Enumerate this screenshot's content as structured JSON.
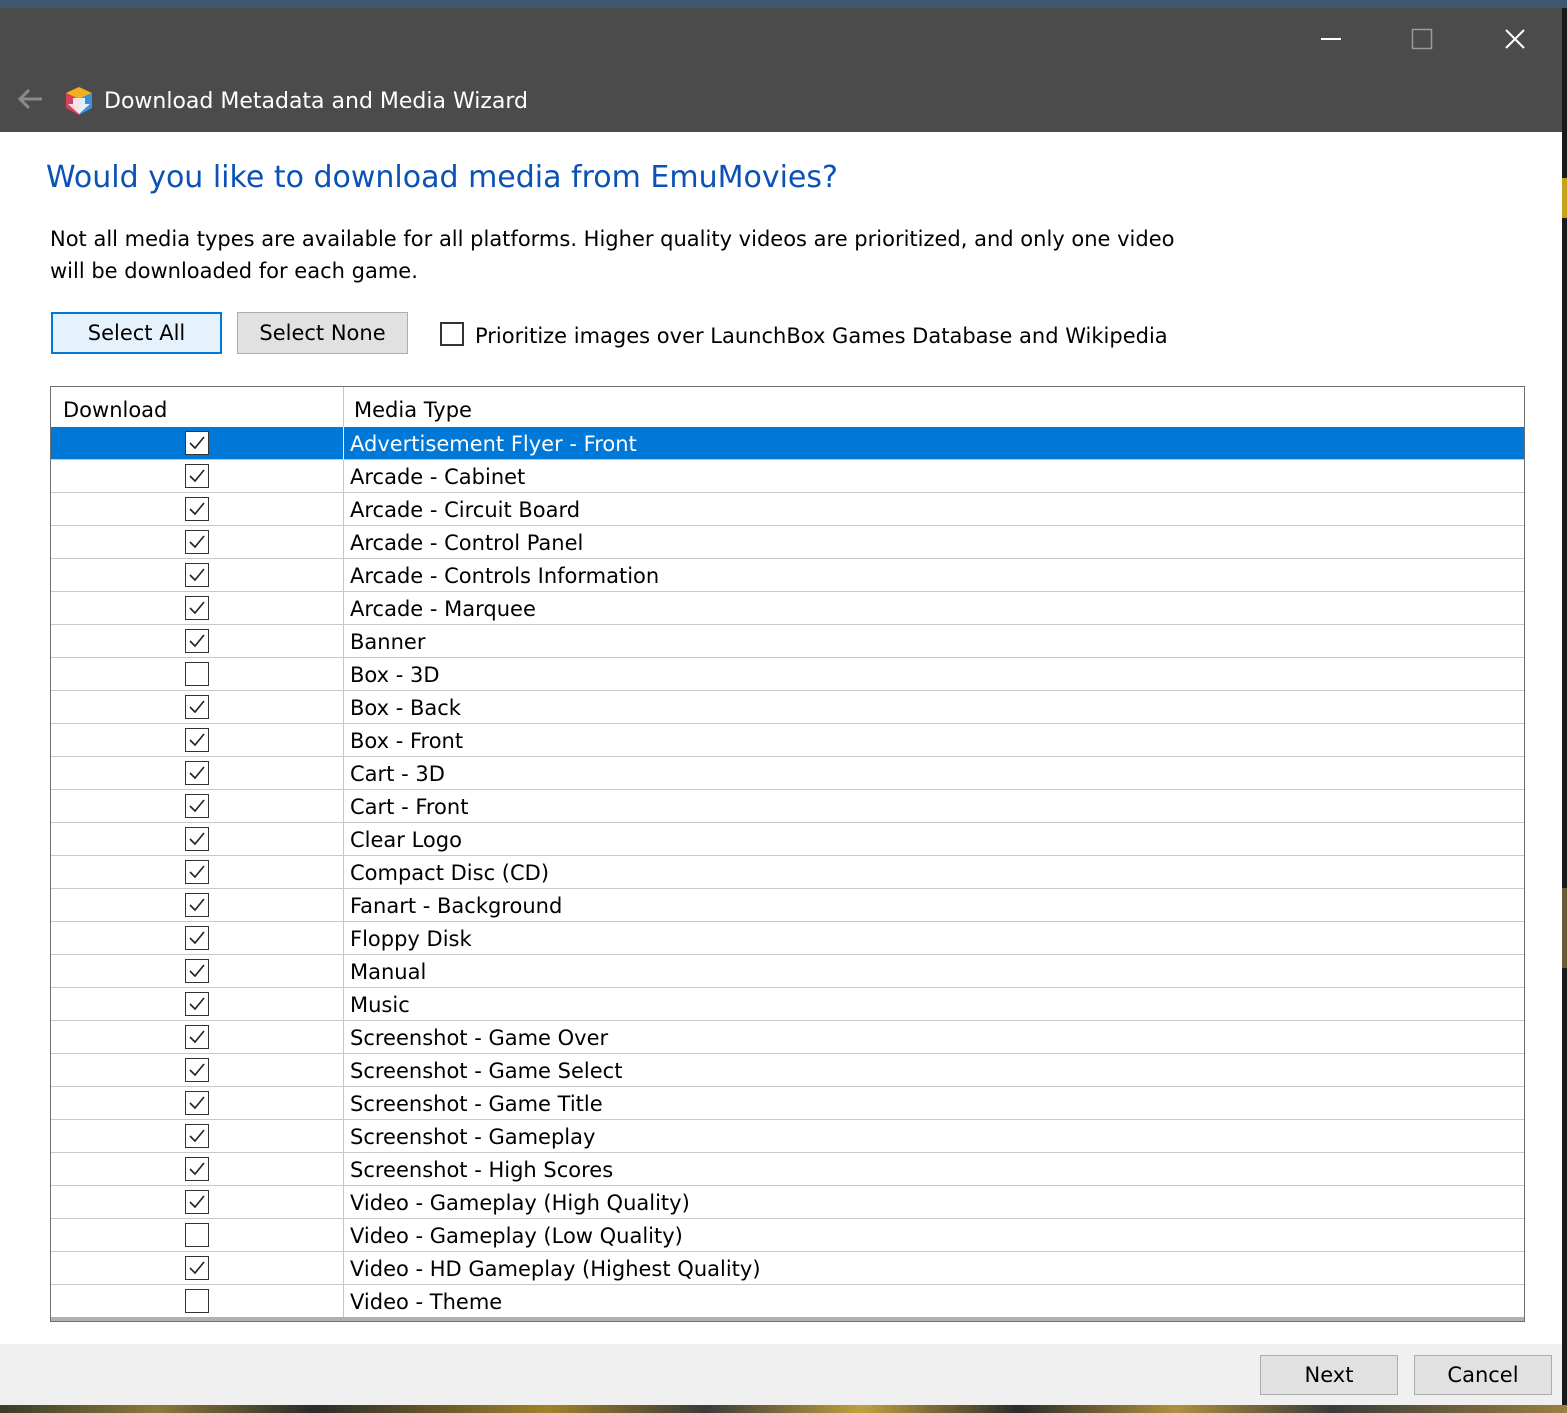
{
  "window": {
    "title": "Download Metadata and Media Wizard",
    "icons": {
      "back": "back-arrow-icon",
      "app": "launchbox-wizard-icon",
      "minimize": "minimize-icon",
      "maximize": "maximize-icon",
      "close": "close-icon"
    }
  },
  "content": {
    "heading": "Would you like to download media from EmuMovies?",
    "description": "Not all media types are available for all platforms. Higher quality videos are prioritized, and only one video will be downloaded for each game.",
    "select_all_label": "Select All",
    "select_none_label": "Select None",
    "prioritize_label": "Prioritize images over LaunchBox Games Database and Wikipedia",
    "prioritize_checked": false
  },
  "grid": {
    "columns": [
      "Download",
      "Media Type"
    ],
    "selected_index": 0,
    "rows": [
      {
        "checked": true,
        "media_type": "Advertisement Flyer - Front"
      },
      {
        "checked": true,
        "media_type": "Arcade - Cabinet"
      },
      {
        "checked": true,
        "media_type": "Arcade - Circuit Board"
      },
      {
        "checked": true,
        "media_type": "Arcade - Control Panel"
      },
      {
        "checked": true,
        "media_type": "Arcade - Controls Information"
      },
      {
        "checked": true,
        "media_type": "Arcade - Marquee"
      },
      {
        "checked": true,
        "media_type": "Banner"
      },
      {
        "checked": false,
        "media_type": "Box - 3D"
      },
      {
        "checked": true,
        "media_type": "Box - Back"
      },
      {
        "checked": true,
        "media_type": "Box - Front"
      },
      {
        "checked": true,
        "media_type": "Cart - 3D"
      },
      {
        "checked": true,
        "media_type": "Cart - Front"
      },
      {
        "checked": true,
        "media_type": "Clear Logo"
      },
      {
        "checked": true,
        "media_type": "Compact Disc (CD)"
      },
      {
        "checked": true,
        "media_type": "Fanart - Background"
      },
      {
        "checked": true,
        "media_type": "Floppy Disk"
      },
      {
        "checked": true,
        "media_type": "Manual"
      },
      {
        "checked": true,
        "media_type": "Music"
      },
      {
        "checked": true,
        "media_type": "Screenshot - Game Over"
      },
      {
        "checked": true,
        "media_type": "Screenshot - Game Select"
      },
      {
        "checked": true,
        "media_type": "Screenshot - Game Title"
      },
      {
        "checked": true,
        "media_type": "Screenshot - Gameplay"
      },
      {
        "checked": true,
        "media_type": "Screenshot - High Scores"
      },
      {
        "checked": true,
        "media_type": "Video - Gameplay (High Quality)"
      },
      {
        "checked": false,
        "media_type": "Video - Gameplay (Low Quality)"
      },
      {
        "checked": true,
        "media_type": "Video - HD Gameplay (Highest Quality)"
      },
      {
        "checked": false,
        "media_type": "Video - Theme"
      }
    ]
  },
  "footer": {
    "next_label": "Next",
    "cancel_label": "Cancel"
  },
  "colors": {
    "titlebar": "#4b4b4b",
    "heading": "#0b52b6",
    "selection": "#0078d7",
    "footer": "#f0f0f0"
  }
}
